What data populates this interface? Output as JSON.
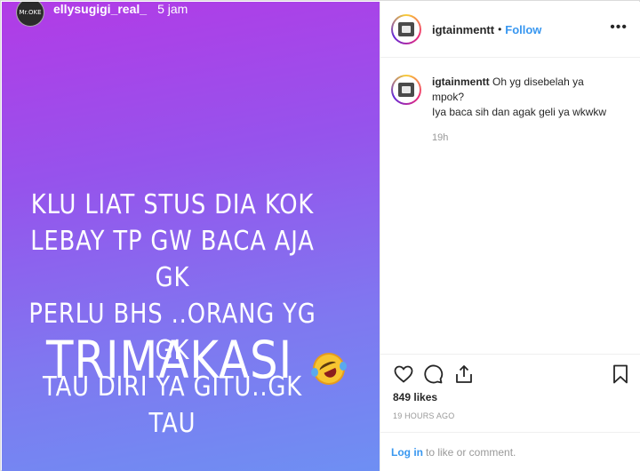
{
  "story": {
    "username": "ellysugigi_real_",
    "time": "5 jam",
    "avatar_text": "Mr.OKE",
    "lines": [
      "KLU LIAT STUS DIA KOK",
      "LEBAY TP GW  BACA AJA GK",
      "PERLU BHS ..ORANG YG GK",
      "TAU DIRI YA GITU..GK TAU"
    ],
    "big_text": "TRIMAKASI",
    "emoji": "rolling-on-floor-laughing-emoji"
  },
  "panel": {
    "header": {
      "username": "igtainmentt",
      "separator": "•",
      "follow_label": "Follow",
      "more_label": "•••"
    },
    "comment": {
      "username": "igtainmentt",
      "text_line1": "Oh yg disebelah ya",
      "text_line2": "mpok?",
      "text_line3": "Iya baca sih dan agak geli ya wkwkw",
      "time": "19h"
    },
    "actions": {
      "icons": [
        "heart-icon",
        "comment-icon",
        "share-icon",
        "bookmark-icon"
      ]
    },
    "likes": "849 likes",
    "time_ago": "19 HOURS AGO",
    "login": {
      "link": "Log in",
      "rest": "to like or comment."
    }
  },
  "colors": {
    "gradient_top": "#b23be6",
    "gradient_bottom": "#6e8ff3",
    "link_blue": "#3897f0",
    "muted": "#999999"
  }
}
